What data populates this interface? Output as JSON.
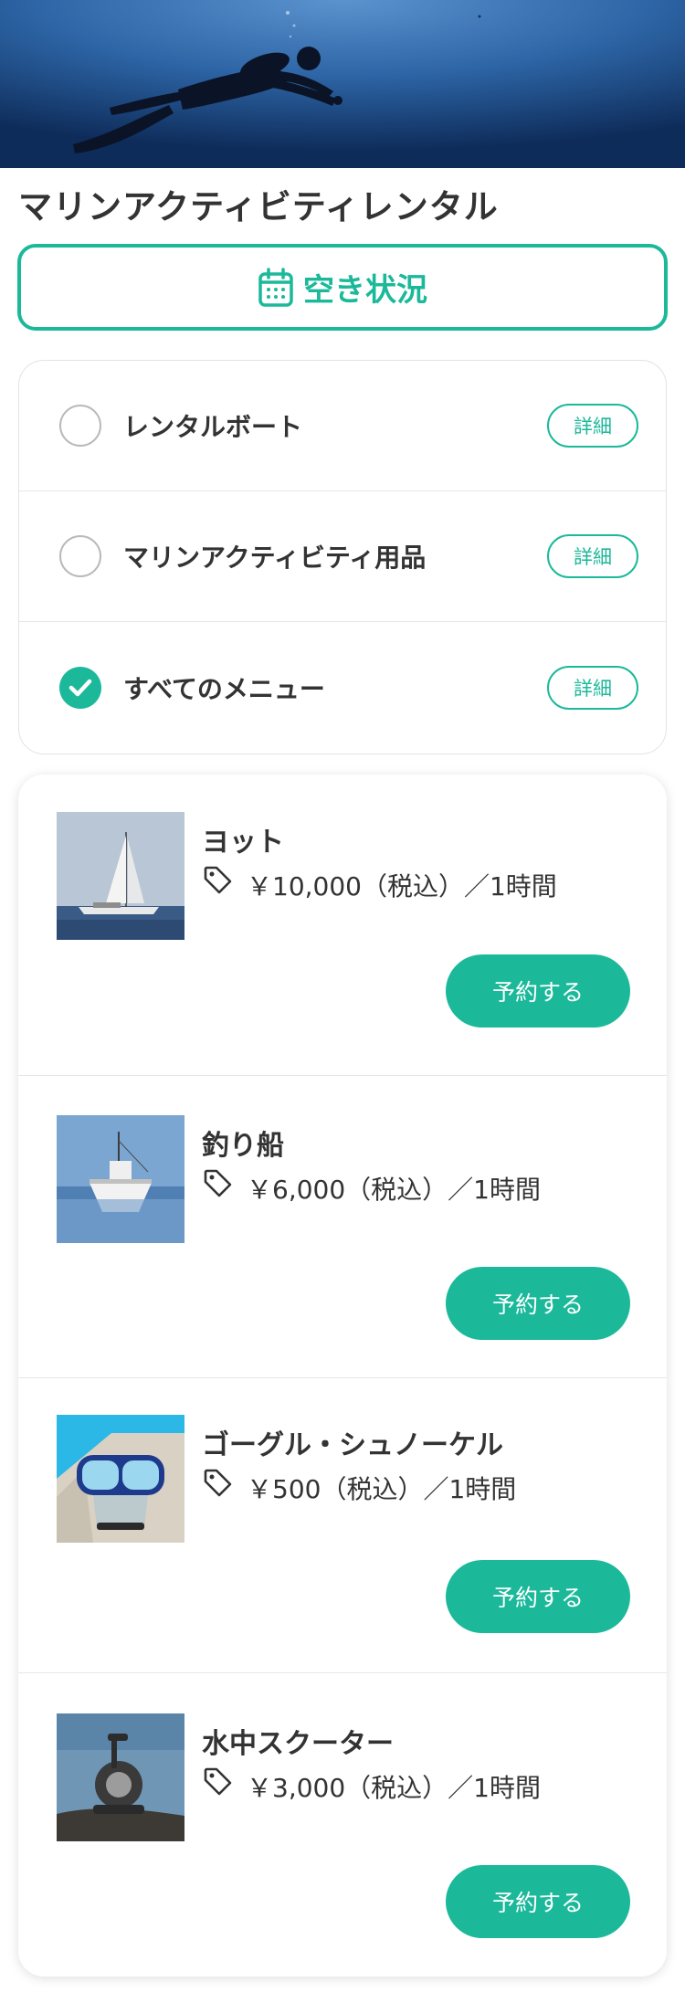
{
  "hero": {
    "image": "scuba-diver-underwater-photo"
  },
  "page": {
    "title": "マリンアクティビティレンタル"
  },
  "availability": {
    "label": "空き状況",
    "icon": "calendar-icon"
  },
  "filters": [
    {
      "label": "レンタルボート",
      "checked": false,
      "detail_label": "詳細"
    },
    {
      "label": "マリンアクティビティ用品",
      "checked": false,
      "detail_label": "詳細"
    },
    {
      "label": "すべてのメニュー",
      "checked": true,
      "detail_label": "詳細"
    }
  ],
  "products": [
    {
      "name": "ヨット",
      "price": "￥10,000（税込）／1時間",
      "reserve_label": "予約する",
      "image": "sailing-yacht-photo"
    },
    {
      "name": "釣り船",
      "price": "￥6,000（税込）／1時間",
      "reserve_label": "予約する",
      "image": "fishing-boat-photo"
    },
    {
      "name": "ゴーグル・シュノーケル",
      "price": "￥500（税込）／1時間",
      "reserve_label": "予約する",
      "image": "snorkel-goggles-photo"
    },
    {
      "name": "水中スクーター",
      "price": "￥3,000（税込）／1時間",
      "reserve_label": "予約する",
      "image": "underwater-scooter-photo"
    }
  ],
  "colors": {
    "accent": "#1bb99a",
    "text": "#333333",
    "border": "#e3e3e3"
  }
}
